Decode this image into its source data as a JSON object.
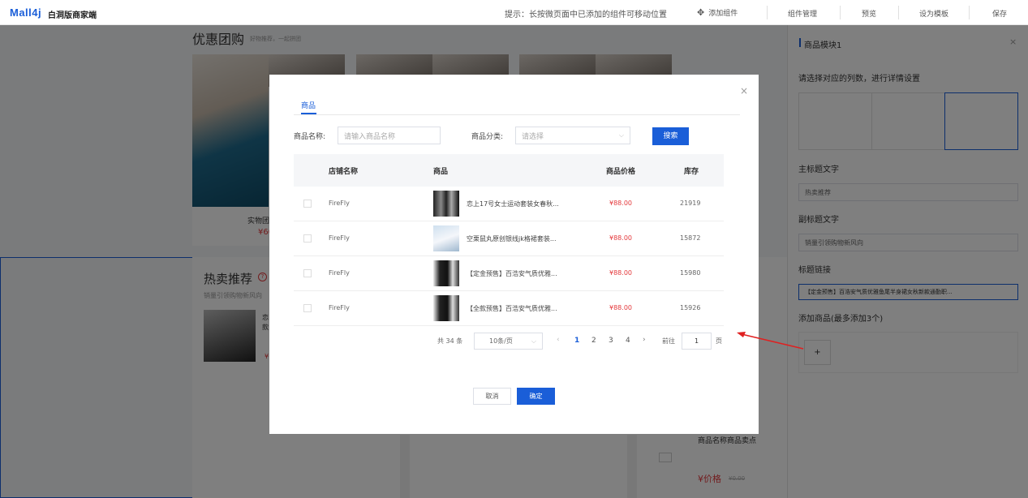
{
  "header": {
    "logo": "Mall4j",
    "subtitle": "白洞版商家端",
    "tip": "提示：长按微页面中已添加的组件可移动位置",
    "add_component": "添加组件",
    "component_manage": "组件管理",
    "preview": "预览",
    "set_template": "设为模板",
    "save": "保存"
  },
  "canvas": {
    "group_buy": {
      "title": "优惠团购",
      "subtitle": "好物推荐，一起拼团",
      "item_name": "实物团",
      "item_price": "¥60"
    },
    "hot": {
      "title": "热卖推荐",
      "subtitle": "销量引领购物新风向",
      "item_name_a": "恋",
      "item_name_b": "款",
      "price_mark": "¥"
    },
    "card": {
      "name": "商品名称商品卖点",
      "price": "¥价格",
      "orig_price": "¥0.00"
    }
  },
  "right_panel": {
    "title": "商品模块1",
    "columns_label": "请选择对应的列数，进行详情设置",
    "main_title_label": "主标题文字",
    "main_title_value": "热卖推荐",
    "sub_title_label": "副标题文字",
    "sub_title_value": "销量引领购物新风向",
    "link_label": "标题链接",
    "link_value": "【定金预售】百浩安气质优雅鱼尾半身裙女秋新款通勤职...",
    "add_goods_label": "添加商品(最多添加3个)",
    "add_plus": "+"
  },
  "modal": {
    "tab": "商品",
    "name_label": "商品名称:",
    "name_placeholder": "请输入商品名称",
    "category_label": "商品分类:",
    "category_placeholder": "请选择",
    "search_btn": "搜索",
    "columns": [
      "店铺名称",
      "商品",
      "商品价格",
      "库存"
    ],
    "rows": [
      {
        "shop": "FireFly",
        "product": "恋上17号女士运动套装女春秋...",
        "price": "¥88.00",
        "stock": "21919"
      },
      {
        "shop": "FireFly",
        "product": "空栗鼠丸原创银线jk格裙套装...",
        "price": "¥88.00",
        "stock": "15872"
      },
      {
        "shop": "FireFly",
        "product": "【定金预售】百浩安气质优雅...",
        "price": "¥88.00",
        "stock": "15980"
      },
      {
        "shop": "FireFly",
        "product": "【全款预售】百浩安气质优雅...",
        "price": "¥88.00",
        "stock": "15926"
      }
    ],
    "pagination": {
      "total": "共 34 条",
      "page_size": "10条/页",
      "pages": [
        "1",
        "2",
        "3",
        "4"
      ],
      "current": "1",
      "goto_label": "前往",
      "goto_value": "1",
      "page_unit": "页"
    },
    "cancel": "取消",
    "confirm": "确定"
  },
  "colors": {
    "accent": "#1a5ed8",
    "price": "#e4393c"
  }
}
